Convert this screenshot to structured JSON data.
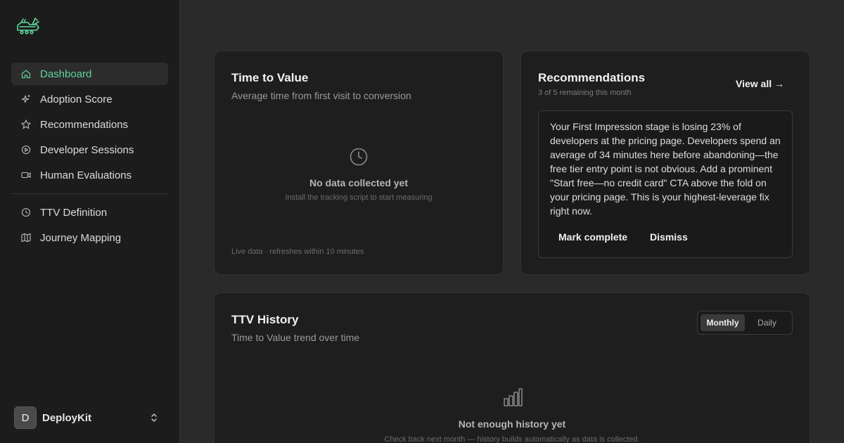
{
  "sidebar": {
    "logo_icon": "deploykit-logo",
    "items": [
      {
        "label": "Dashboard",
        "icon": "home-icon",
        "active": true
      },
      {
        "label": "Adoption Score",
        "icon": "sparkle-icon"
      },
      {
        "label": "Recommendations",
        "icon": "star-icon"
      },
      {
        "label": "Developer Sessions",
        "icon": "play-circle-icon"
      },
      {
        "label": "Human Evaluations",
        "icon": "video-icon"
      }
    ],
    "items2": [
      {
        "label": "TTV Definition",
        "icon": "clock-icon"
      },
      {
        "label": "Journey Mapping",
        "icon": "map-icon"
      }
    ],
    "workspace": {
      "initial": "D",
      "name": "DeployKit",
      "icon": "chevron-up-down-icon"
    }
  },
  "ttv_card": {
    "title": "Time to Value",
    "subtitle": "Average time from first visit to conversion",
    "empty_title": "No data collected yet",
    "empty_subtitle": "Install the tracking script to start measuring",
    "footnote": "Live data · refreshes within 10 minutes"
  },
  "recommendations": {
    "title": "Recommendations",
    "subtitle": "3 of 5 remaining this month",
    "view_all": "View all →",
    "text": "Your First Impression stage is losing 23% of developers at the pricing page. Developers spend an average of 34 minutes here before abandoning—the free tier entry point is not obvious. Add a prominent \"Start free—no credit card\" CTA above the fold on your pricing page. This is your highest-leverage fix right now.",
    "mark_complete": "Mark complete",
    "dismiss": "Dismiss"
  },
  "history": {
    "title": "TTV History",
    "subtitle": "Time to Value trend over time",
    "toggle": {
      "monthly": "Monthly",
      "daily": "Daily",
      "selected": "Monthly"
    },
    "empty_title": "Not enough history yet",
    "empty_subtitle": "Check back next month — history builds automatically as data is collected."
  },
  "colors": {
    "accent": "#5fd49b",
    "background": "#2a2a2a",
    "sidebar": "#1c1c1c",
    "card": "#1e1e1e"
  }
}
